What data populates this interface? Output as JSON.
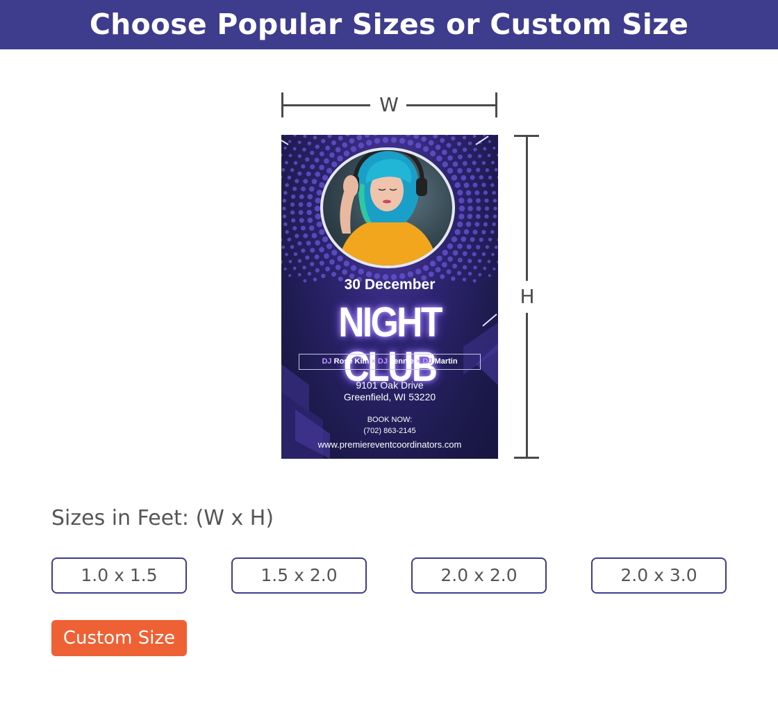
{
  "header": {
    "title": "Choose Popular Sizes or Custom Size"
  },
  "dimensions": {
    "width_label": "W",
    "height_label": "H"
  },
  "poster": {
    "date": "30 December",
    "title": "NIGHT CLUB",
    "djs": [
      {
        "prefix": "DJ",
        "name": "Rose Kim"
      },
      {
        "prefix": "DJ",
        "name": "Jennie"
      },
      {
        "prefix": "DJ",
        "name": "Martin"
      }
    ],
    "dj_separator": "×",
    "address_line1": "9101 Oak Drive",
    "address_line2": "Greenfield, WI 53220",
    "book_now": "BOOK NOW:",
    "phone": "(702) 863-2145",
    "website": "www.premiereventcoordinators.com"
  },
  "sizes": {
    "label": "Sizes in Feet: (W x H)",
    "options": [
      "1.0 x 1.5",
      "1.5 x 2.0",
      "2.0 x 2.0",
      "2.0 x 3.0"
    ]
  },
  "custom": {
    "label": "Custom Size"
  },
  "colors": {
    "header_bg": "#3e3c8c",
    "button_border": "#3e3c8c",
    "custom_button_bg": "#ee6134",
    "text_gray": "#555555"
  }
}
